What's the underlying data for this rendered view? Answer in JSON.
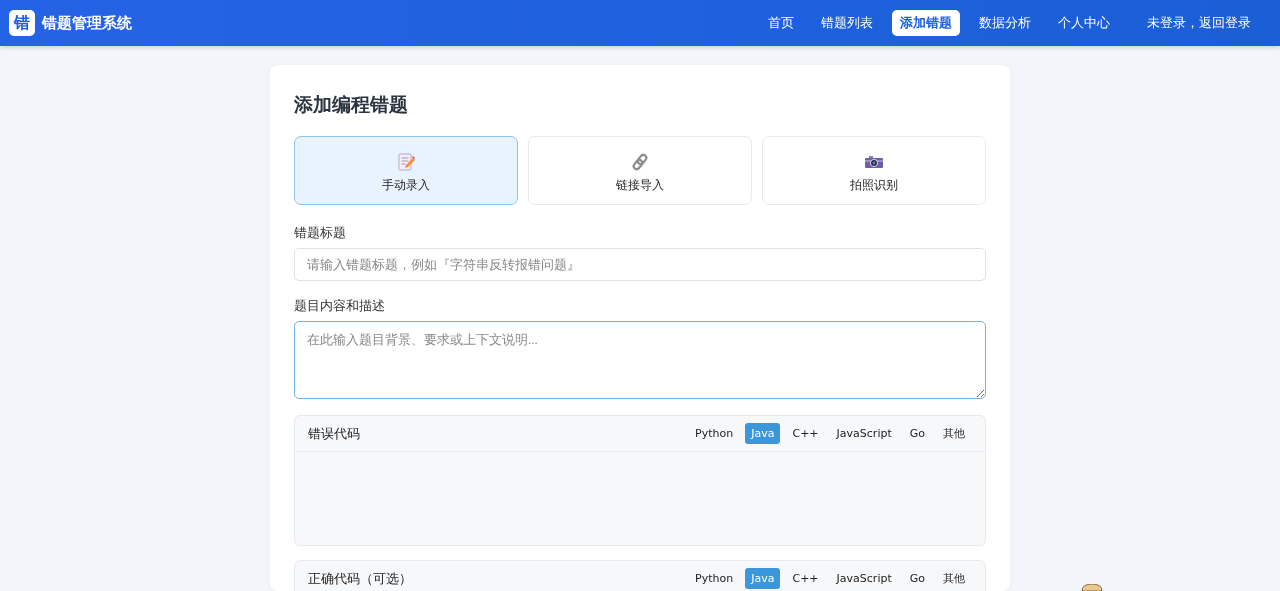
{
  "nav": {
    "logo": "错",
    "title": "错题管理系统",
    "links": [
      {
        "label": "首页",
        "selected": false
      },
      {
        "label": "错题列表",
        "selected": false
      },
      {
        "label": "添加错题",
        "selected": true
      },
      {
        "label": "数据分析",
        "selected": false
      },
      {
        "label": "个人中心",
        "selected": false
      },
      {
        "label": "未登录，返回登录",
        "selected": false
      }
    ]
  },
  "form": {
    "title": "添加编程错题",
    "methods": [
      {
        "label": "手动录入",
        "kind": "manual",
        "selected": true
      },
      {
        "label": "链接导入",
        "kind": "link",
        "selected": false
      },
      {
        "label": "拍照识别",
        "kind": "camera",
        "selected": false
      }
    ],
    "fields": [
      {
        "kind": "input",
        "label": "错题标题",
        "placeholder": "请输入错题标题，例如『字符串反转报错问题』",
        "focused": false
      },
      {
        "kind": "textarea",
        "label": "题目内容和描述",
        "placeholder": "在此输入题目背景、要求或上下文说明...",
        "focused": true
      }
    ],
    "code_panels": [
      {
        "title": "错误代码",
        "languages": [
          {
            "label": "Python",
            "selected": false
          },
          {
            "label": "Java",
            "selected": true
          },
          {
            "label": "C++",
            "selected": false
          },
          {
            "label": "JavaScript",
            "selected": false
          },
          {
            "label": "Go",
            "selected": false
          },
          {
            "label": "其他",
            "selected": false
          }
        ]
      },
      {
        "title": "正确代码（可选）",
        "languages": [
          {
            "label": "Python",
            "selected": false
          },
          {
            "label": "Java",
            "selected": true
          },
          {
            "label": "C++",
            "selected": false
          },
          {
            "label": "JavaScript",
            "selected": false
          },
          {
            "label": "Go",
            "selected": false
          },
          {
            "label": "其他",
            "selected": false
          }
        ]
      }
    ]
  }
}
